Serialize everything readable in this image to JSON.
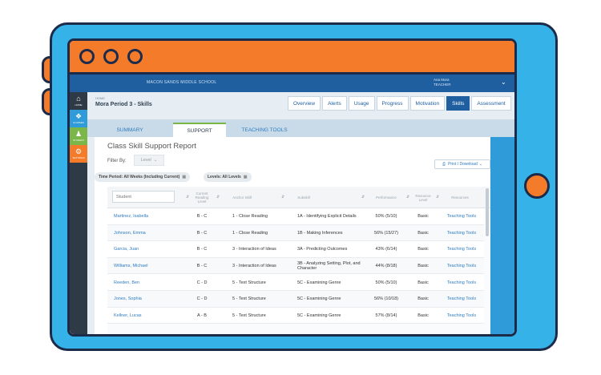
{
  "app": {
    "school": "MACON SANDS MIDDLE SCHOOL",
    "user_name": "Ana Mora",
    "user_role": "TEACHER"
  },
  "sidebar": {
    "items": [
      {
        "label": "HOME",
        "icon": "home-icon",
        "color": "#2f3a47"
      },
      {
        "label": "CLASSES",
        "icon": "people-icon",
        "color": "#2f9bd8"
      },
      {
        "label": "STUDENT",
        "icon": "student-icon",
        "color": "#7ab648"
      },
      {
        "label": "SETTINGS",
        "icon": "gear-icon",
        "color": "#f47b2a"
      }
    ]
  },
  "header": {
    "breadcrumb": "HOME",
    "title": "Mora Period 3 - Skills",
    "tabs": [
      "Overview",
      "Alerts",
      "Usage",
      "Progress",
      "Motivation",
      "Skills",
      "Assessment"
    ],
    "active_tab": "Skills"
  },
  "subtabs": {
    "items": [
      "SUMMARY",
      "SUPPORT",
      "TEACHING TOOLS"
    ],
    "active": "SUPPORT"
  },
  "report": {
    "title": "Class Skill Support Report",
    "filter_label": "Filter By:",
    "filter_value": "Level",
    "print_label": "Print / Download",
    "chips": [
      "Time Period: All Weeks (Including Current)",
      "Levels: All Levels"
    ]
  },
  "table": {
    "search_placeholder": "Student",
    "headers": [
      "Current Reading Level",
      "Anchor Skill",
      "Subskill",
      "Performance",
      "Resource Level",
      "Resources"
    ],
    "rows": [
      {
        "student": "Martinez, Isabella",
        "level": "B - C",
        "anchor": "1 - Close Reading",
        "subskill": "1A - Identifying Explicit Details",
        "performance": "50% (5/10)",
        "resource_level": "Basic",
        "resources": "Teaching Tools"
      },
      {
        "student": "Johnson, Emma",
        "level": "B - C",
        "anchor": "1 - Close Reading",
        "subskill": "1B - Making Inferences",
        "performance": "56% (15/27)",
        "resource_level": "Basic",
        "resources": "Teaching Tools"
      },
      {
        "student": "Garcia, Juan",
        "level": "B - C",
        "anchor": "3 - Interaction of Ideas",
        "subskill": "3A - Predicting Outcomes",
        "performance": "43% (6/14)",
        "resource_level": "Basic",
        "resources": "Teaching Tools"
      },
      {
        "student": "Williams, Michael",
        "level": "B - C",
        "anchor": "3 - Interaction of Ideas",
        "subskill": "3B - Analyzing Setting, Plot, and Character",
        "performance": "44% (8/18)",
        "resource_level": "Basic",
        "resources": "Teaching Tools"
      },
      {
        "student": "Reeden, Ben",
        "level": "C - D",
        "anchor": "5 - Text Structure",
        "subskill": "5C - Examining Genre",
        "performance": "50% (5/10)",
        "resource_level": "Basic",
        "resources": "Teaching Tools"
      },
      {
        "student": "Jones, Sophia",
        "level": "C - D",
        "anchor": "5 - Text Structure",
        "subskill": "5C - Examining Genre",
        "performance": "56% (10/18)",
        "resource_level": "Basic",
        "resources": "Teaching Tools"
      },
      {
        "student": "Kellner, Lucas",
        "level": "A - B",
        "anchor": "5 - Text Structure",
        "subskill": "5C - Examining Genre",
        "performance": "57% (8/14)",
        "resource_level": "Basic",
        "resources": "Teaching Tools"
      }
    ]
  },
  "colors": {
    "frame": "#35b3e8",
    "accent_orange": "#f47b2a",
    "appbar": "#1f5fa0",
    "link": "#2f7cc1"
  }
}
